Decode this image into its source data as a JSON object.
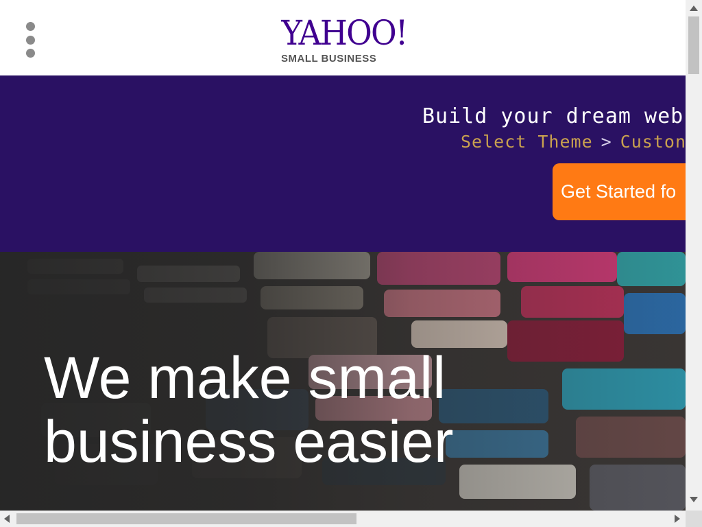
{
  "header": {
    "menu_icon": "kebab-menu-icon",
    "logo": {
      "brand": "YAHOO!",
      "tagline": "SMALL BUSINESS"
    }
  },
  "promo": {
    "headline": "Build your dream web",
    "steps": {
      "step1": "Select Theme",
      "separator": ">",
      "step2": "Custon"
    },
    "cta_label": "Get Started fo"
  },
  "hero": {
    "title_line1": "We make small",
    "title_line2": "business easier"
  },
  "colors": {
    "brand_purple": "#400090",
    "banner_bg": "#2a1163",
    "step_gold": "#c9a14f",
    "cta_orange": "#ff7a14"
  }
}
